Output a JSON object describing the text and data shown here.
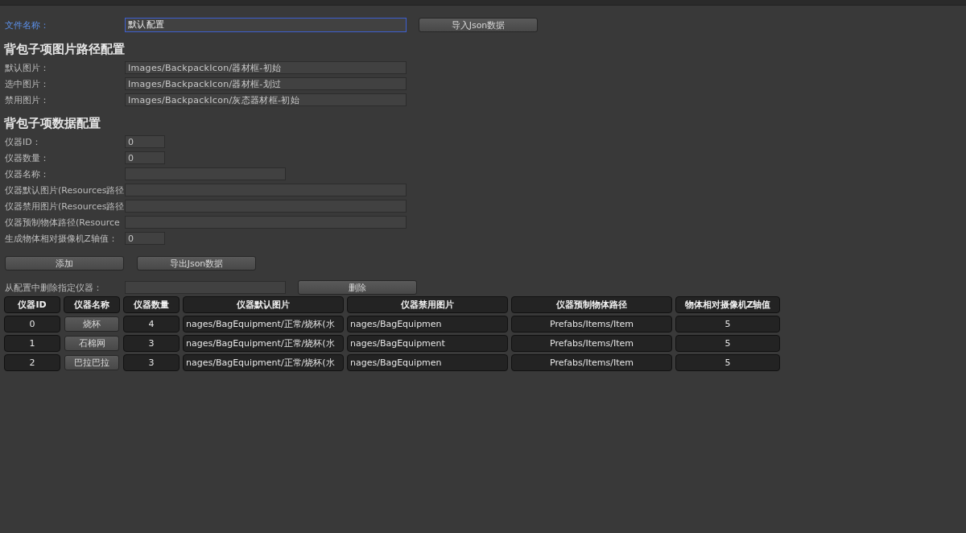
{
  "file_name": {
    "label": "文件名称：",
    "value": "默认配置",
    "focused": true
  },
  "import_button": "导入Json数据",
  "image_paths": {
    "title": "背包子项图片路径配置",
    "fields": [
      {
        "label": "默认图片：",
        "value": "Images/BackpackIcon/器材框-初始"
      },
      {
        "label": "选中图片：",
        "value": "Images/BackpackIcon/器材框-划过"
      },
      {
        "label": "禁用图片：",
        "value": "Images/BackpackIcon/灰态器材框-初始"
      }
    ]
  },
  "item_data": {
    "title": "背包子项数据配置",
    "fields": [
      {
        "label": "仪器ID：",
        "value": "0",
        "kind": "short"
      },
      {
        "label": "仪器数量：",
        "value": "0",
        "kind": "short"
      },
      {
        "label": "仪器名称：",
        "kind": "medium"
      },
      {
        "label": "仪器默认图片(Resources路径",
        "kind": "long"
      },
      {
        "label": "仪器禁用图片(Resources路径",
        "kind": "long"
      },
      {
        "label": "仪器预制物体路径(Resource",
        "kind": "long"
      },
      {
        "label": "生成物体相对摄像机Z轴值：",
        "value": "0",
        "kind": "short"
      }
    ]
  },
  "add_button": "添加",
  "export_button": "导出Json数据",
  "delete": {
    "label": "从配置中删除指定仪器：",
    "button": "删除"
  },
  "table": {
    "columns": [
      "仪器ID",
      "仪器名称",
      "仪器数量",
      "仪器默认图片",
      "仪器禁用图片",
      "仪器预制物体路径",
      "物体相对摄像机Z轴值"
    ],
    "rows": [
      {
        "id": "0",
        "name": "烧杯",
        "quantity": "4",
        "default_image": "nages/BagEquipment/正常/烧杯(水",
        "disabled_image": "nages/BagEquipmen",
        "prefab_path": "Prefabs/Items/Item",
        "z_value": "5"
      },
      {
        "id": "1",
        "name": "石棉网",
        "quantity": "3",
        "default_image": "nages/BagEquipment/正常/烧杯(水",
        "disabled_image": "nages/BagEquipment",
        "prefab_path": "Prefabs/Items/Item",
        "z_value": "5"
      },
      {
        "id": "2",
        "name": "巴拉巴拉",
        "quantity": "3",
        "default_image": "nages/BagEquipment/正常/烧杯(水",
        "disabled_image": "nages/BagEquipmen",
        "prefab_path": "Prefabs/Items/Item",
        "z_value": "5"
      }
    ]
  }
}
